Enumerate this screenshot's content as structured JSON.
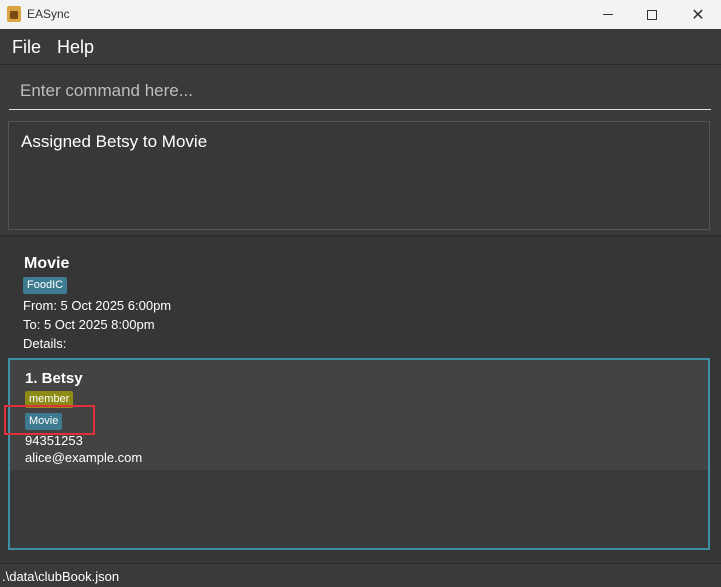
{
  "window": {
    "title": "EASync",
    "minimize_icon": "minimize-icon",
    "maximize_icon": "maximize-icon",
    "close_icon": "close-icon"
  },
  "menu": {
    "items": [
      "File",
      "Help"
    ]
  },
  "command": {
    "placeholder": "Enter command here...",
    "value": ""
  },
  "result": {
    "message": "Assigned Betsy to Movie"
  },
  "event": {
    "name": "Movie",
    "tag": "FoodIC",
    "from": "From: 5 Oct 2025 6:00pm",
    "to": "To: 5 Oct 2025 8:00pm",
    "details": "Details:"
  },
  "members": [
    {
      "name": "1. Betsy",
      "role": "member",
      "event_tag": "Movie",
      "phone": "94351253",
      "email": "alice@example.com"
    }
  ],
  "status": {
    "path": ".\\data\\clubBook.json"
  },
  "colors": {
    "background": "#3a3a3a",
    "tag_blue": "#3e7b91",
    "tag_olive": "#8b8b16",
    "selection_border": "#3e8ea6",
    "annotation_red": "#e0303b"
  }
}
